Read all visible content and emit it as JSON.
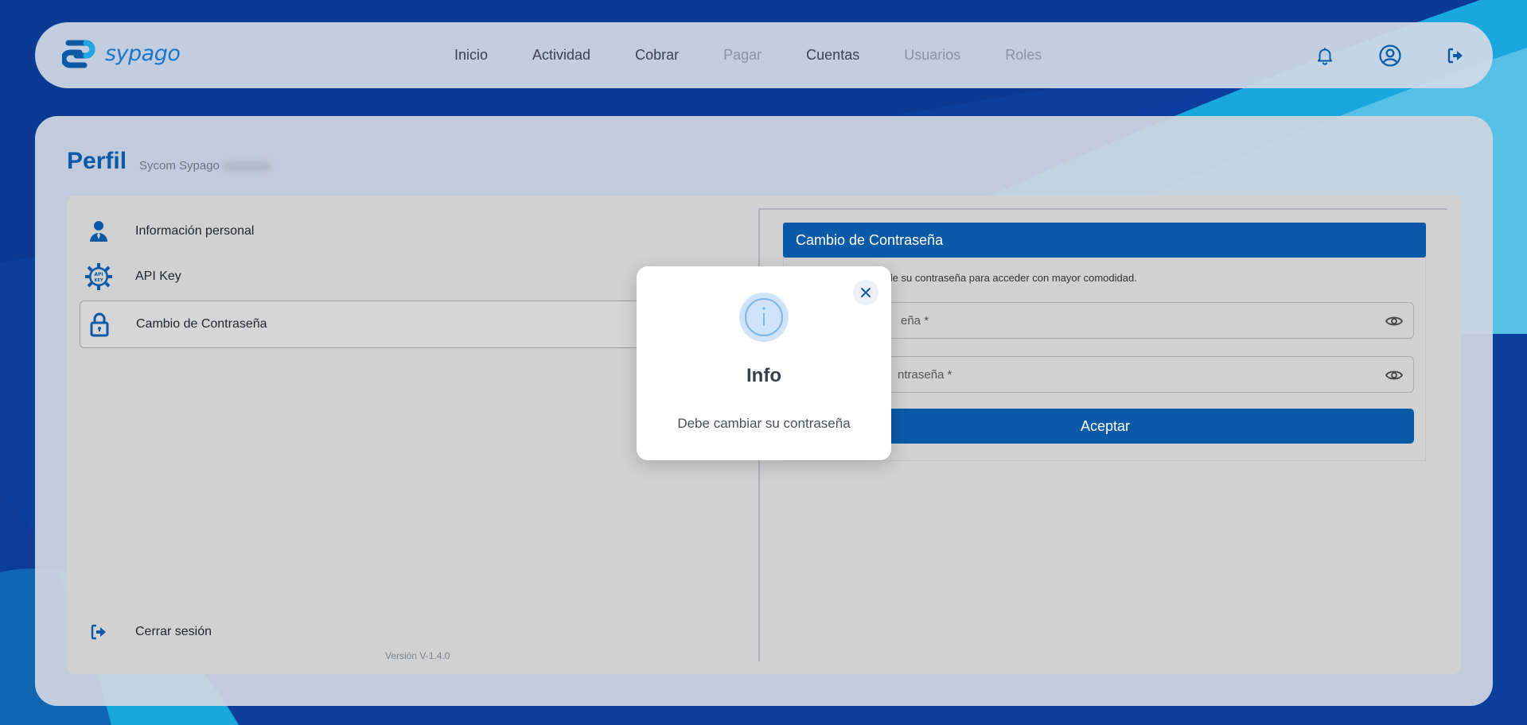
{
  "brand": {
    "name": "sypago",
    "primary_color": "#0a5aa8",
    "accent_color": "#1977c9"
  },
  "nav": {
    "items": [
      {
        "label": "Inicio",
        "enabled": true
      },
      {
        "label": "Actividad",
        "enabled": true
      },
      {
        "label": "Cobrar",
        "enabled": true
      },
      {
        "label": "Pagar",
        "enabled": false
      },
      {
        "label": "Cuentas",
        "enabled": true
      },
      {
        "label": "Usuarios",
        "enabled": false
      },
      {
        "label": "Roles",
        "enabled": false
      }
    ],
    "icons": [
      "bell-icon",
      "user-circle-icon",
      "logout-icon"
    ]
  },
  "page": {
    "title": "Perfil",
    "subtitle": "Sycom Sypago"
  },
  "sidebar": {
    "items": [
      {
        "label": "Información personal",
        "icon": "person-icon",
        "active": false
      },
      {
        "label": "API Key",
        "icon": "api-key-gear-icon",
        "active": false
      },
      {
        "label": "Cambio de Contraseña",
        "icon": "lock-icon",
        "active": true
      }
    ],
    "logout_label": "Cerrar sesión",
    "version": "Versión V-1.4.0"
  },
  "password_panel": {
    "header": "Cambio de Contraseña",
    "description": "de hacer el cambio de su contraseña para acceder con mayor comodidad.",
    "field1_partial": "eña *",
    "field2_partial": "ntraseña *",
    "accept_label": "Aceptar"
  },
  "modal": {
    "title": "Info",
    "message": "Debe cambiar su contraseña",
    "icon": "info-icon"
  }
}
